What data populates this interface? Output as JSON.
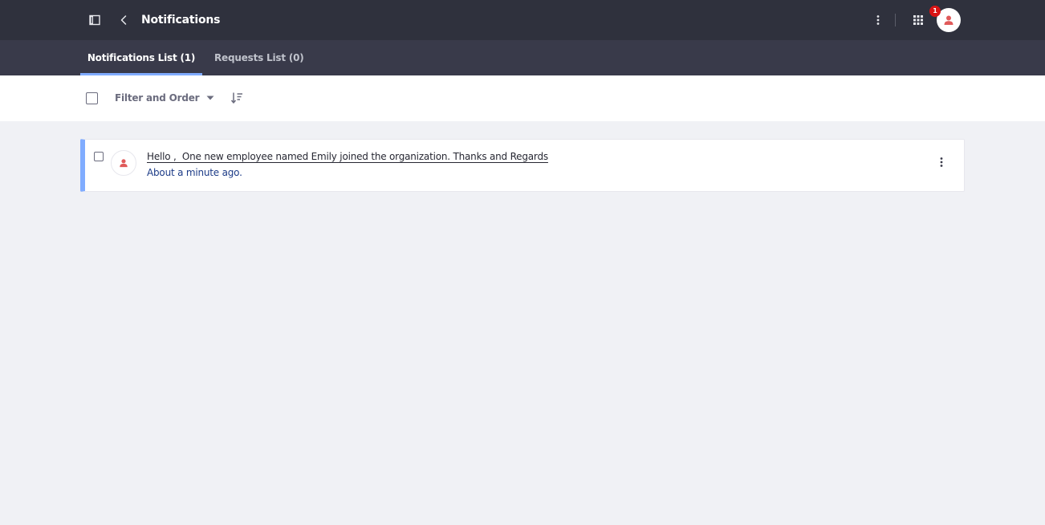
{
  "header": {
    "title": "Notifications",
    "notification_count": "1",
    "icons": [
      "sidebar-toggle-icon",
      "chevron-left-icon",
      "ellipsis-v-icon",
      "apps-grid-icon",
      "user-icon"
    ]
  },
  "tabs": [
    {
      "label": "Notifications List (1)",
      "active": true
    },
    {
      "label": "Requests List (0)",
      "active": false
    }
  ],
  "toolbar": {
    "filter_label": "Filter and Order"
  },
  "notifications": [
    {
      "message": "Hello ,  One new employee named Emily joined the organization. Thanks and Regards",
      "time": "About a minute ago.",
      "unread": true
    }
  ],
  "colors": {
    "topbar": "#2f313d",
    "tabbar": "#393a4a",
    "accent": "#80acff",
    "badge": "#da1414",
    "avatar_icon": "#e05a5a"
  }
}
